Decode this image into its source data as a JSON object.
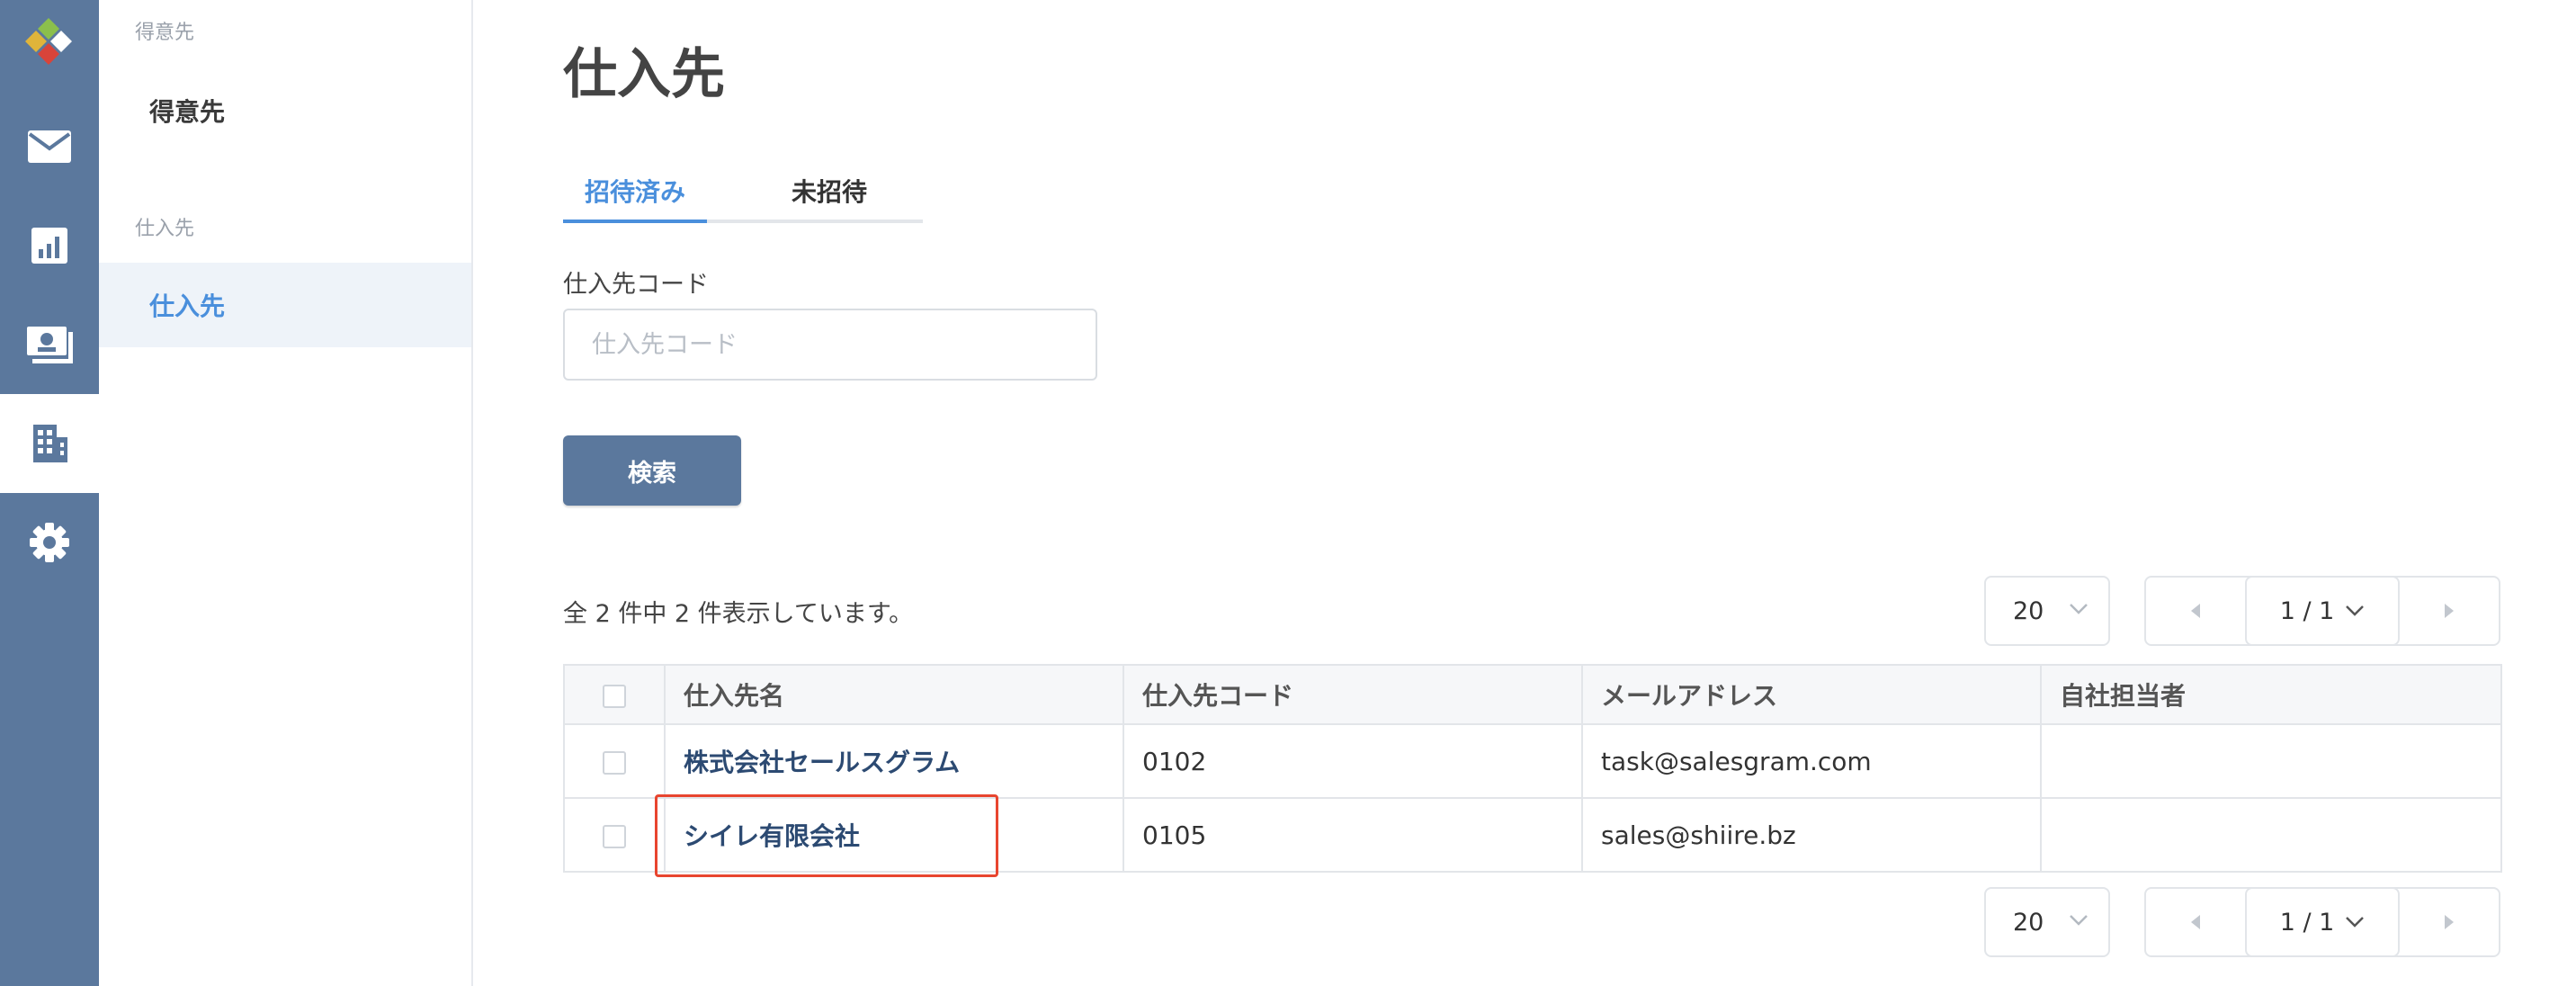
{
  "colors": {
    "rail": "#5b789d",
    "accent": "#4a8fdc",
    "link": "#2c4a72",
    "highlight": "#e8452f"
  },
  "rail": {
    "items": [
      {
        "icon": "mail-icon"
      },
      {
        "icon": "bar-chart-icon"
      },
      {
        "icon": "screen-icon"
      },
      {
        "icon": "building-icon",
        "active": true
      },
      {
        "icon": "gear-icon"
      }
    ]
  },
  "subnav": {
    "section1": {
      "heading": "得意先",
      "item": "得意先"
    },
    "section2": {
      "heading": "仕入先",
      "item": "仕入先"
    }
  },
  "page": {
    "title": "仕入先"
  },
  "tabs": [
    {
      "label": "招待済み",
      "active": true
    },
    {
      "label": "未招待",
      "active": false
    }
  ],
  "filter": {
    "label": "仕入先コード",
    "placeholder": "仕入先コード",
    "value": "",
    "search_label": "検索"
  },
  "summary": "全 2 件中 2 件表示しています。",
  "pagination": {
    "per_page": "20",
    "page_label": "1 / 1"
  },
  "table": {
    "headers": [
      "仕入先名",
      "仕入先コード",
      "メールアドレス",
      "自社担当者"
    ],
    "rows": [
      {
        "name": "株式会社セールスグラム",
        "code": "0102",
        "email": "task@salesgram.com",
        "owner": ""
      },
      {
        "name": "シイレ有限会社",
        "code": "0105",
        "email": "sales@shiire.bz",
        "owner": ""
      }
    ]
  }
}
